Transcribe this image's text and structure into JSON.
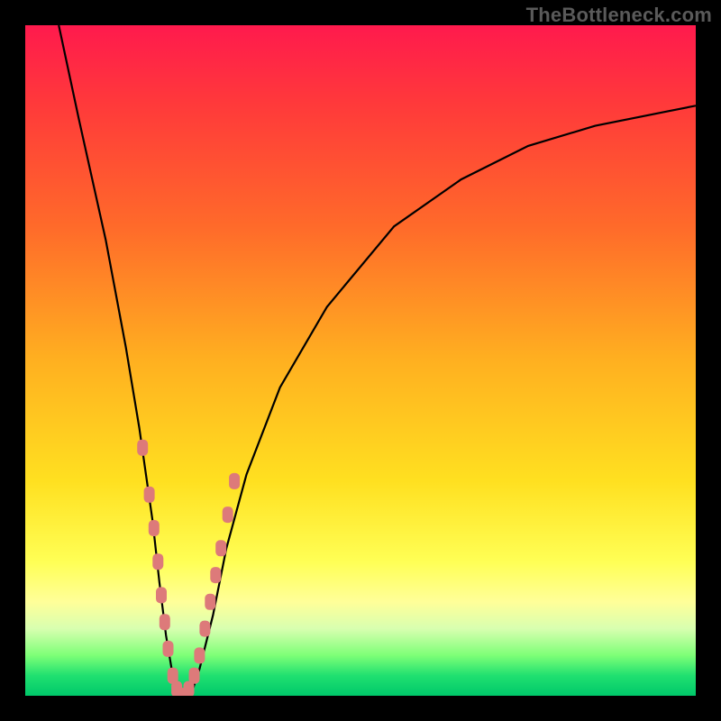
{
  "watermark": "TheBottleneck.com",
  "colors": {
    "frame": "#000000",
    "gradient_top": "#ff1a4d",
    "gradient_bottom": "#00c86a",
    "curve": "#000000",
    "marker": "#dd7a7a"
  },
  "chart_data": {
    "type": "line",
    "title": "",
    "xlabel": "",
    "ylabel": "",
    "xlim": [
      0,
      100
    ],
    "ylim": [
      0,
      100
    ],
    "grid": false,
    "legend": false,
    "curve": {
      "x": [
        5,
        8,
        12,
        15,
        17,
        19,
        20,
        21,
        22,
        23,
        24,
        25,
        26,
        28,
        30,
        33,
        38,
        45,
        55,
        65,
        75,
        85,
        95,
        100
      ],
      "y": [
        100,
        86,
        68,
        52,
        40,
        26,
        17,
        9,
        3,
        0,
        0,
        1,
        4,
        12,
        22,
        33,
        46,
        58,
        70,
        77,
        82,
        85,
        87,
        88
      ]
    },
    "markers": {
      "x": [
        17.5,
        18.5,
        19.2,
        19.8,
        20.3,
        20.8,
        21.3,
        22.0,
        22.6,
        23.2,
        23.8,
        24.4,
        25.2,
        26.0,
        26.8,
        27.6,
        28.4,
        29.2,
        30.2,
        31.2
      ],
      "y": [
        37,
        30,
        25,
        20,
        15,
        11,
        7,
        3,
        1,
        0,
        0,
        1,
        3,
        6,
        10,
        14,
        18,
        22,
        27,
        32
      ],
      "shape": "rounded-rect"
    }
  }
}
